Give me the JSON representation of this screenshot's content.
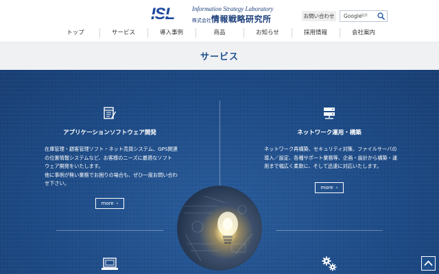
{
  "header": {
    "logo": {
      "mark": "ISL",
      "english": "Information Strategy Laboratory",
      "kabushiki": "株式会社",
      "japanese": "情報戦略研究所"
    },
    "contact_label": "お問い合わせ",
    "search": {
      "google_label": "Google",
      "provided_label": "提供"
    },
    "nav": [
      "トップ",
      "サービス",
      "導入事例",
      "商品",
      "お知らせ",
      "採用情報",
      "会社案内"
    ]
  },
  "page_title": "サービス",
  "services": {
    "app": {
      "title": "アプリケーションソフトウェア開発",
      "desc": [
        "在庫管理・顧客管理ソフト・ネット売買システム、GPS関連",
        "の位置情報システムなど、お客様のニーズに最適なソフト",
        "ウェア開発をいたします。",
        "他に事例が無い業務でお困りの場合も、ぜひ一度お問い合わ",
        "せ下さい。"
      ],
      "more": "more"
    },
    "network": {
      "title": "ネットワーク運用・構築",
      "desc": [
        "ネットワーク再構築、セキュリティ対策、ファイルサーバの",
        "導入／設定、各種サポート業務等、企画・設計から構築・運",
        "用まで幅広く柔軟に、そして迅速に対応いたします。"
      ],
      "more": "more"
    }
  },
  "colors": {
    "brand_blue": "#1f4a9c",
    "main_bg": "#1f4f8d",
    "title_band": "#f0f1f3",
    "title_text": "#1a4d8c"
  },
  "icons": [
    "document-icon",
    "server-icon",
    "laptop-icon",
    "gears-icon",
    "search-icon",
    "chevron-right-icon",
    "chevron-up-icon"
  ]
}
